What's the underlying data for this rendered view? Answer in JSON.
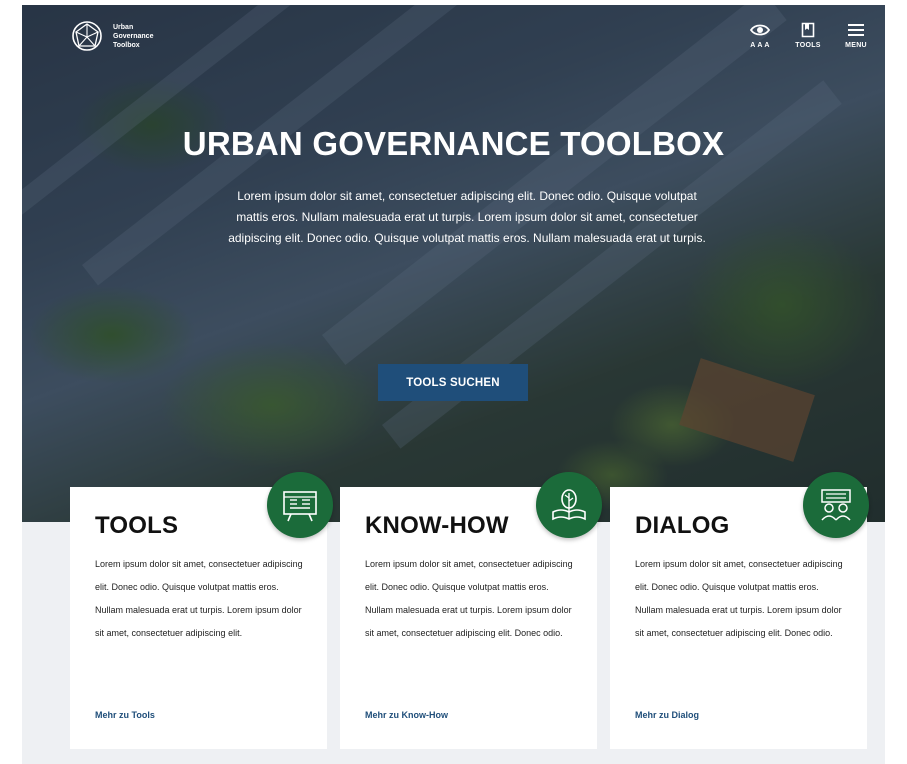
{
  "logo": {
    "line1": "Urban",
    "line2": "Governance",
    "line3": "Toolbox"
  },
  "nav": [
    {
      "label": "A A A",
      "icon": "eye-icon"
    },
    {
      "label": "TOOLS",
      "icon": "bookmark-icon"
    },
    {
      "label": "MENU",
      "icon": "menu-icon"
    }
  ],
  "hero": {
    "title": "URBAN GOVERNANCE TOOLBOX",
    "text": "Lorem ipsum dolor sit amet, consectetuer adipiscing elit. Donec odio. Quisque volutpat mattis eros. Nullam malesuada erat ut turpis. Lorem ipsum dolor sit amet, consectetuer adipiscing elit. Donec odio. Quisque volutpat mattis eros. Nullam malesuada erat ut turpis.",
    "cta": "TOOLS SUCHEN"
  },
  "cards": [
    {
      "title": "TOOLS",
      "text": "Lorem ipsum dolor sit amet, consectetuer adipiscing elit. Donec odio. Quisque volutpat mattis eros. Nullam malesuada erat ut turpis. Lorem ipsum dolor sit amet, consectetuer adipiscing elit.",
      "link": "Mehr zu Tools",
      "icon": "tools-board-icon"
    },
    {
      "title": "KNOW-HOW",
      "text": "Lorem ipsum dolor sit amet, consectetuer adipiscing elit. Donec odio. Quisque volutpat mattis eros. Nullam malesuada erat ut turpis. Lorem ipsum dolor sit amet, consectetuer adipiscing elit. Donec odio.",
      "link": "Mehr zu Know-How",
      "icon": "book-tree-icon"
    },
    {
      "title": "DIALOG",
      "text": "Lorem ipsum dolor sit amet, consectetuer adipiscing elit. Donec odio. Quisque volutpat mattis eros. Nullam malesuada erat ut turpis. Lorem ipsum dolor sit amet, consectetuer adipiscing elit. Donec odio.",
      "link": "Mehr zu Dialog",
      "icon": "people-dialog-icon"
    }
  ],
  "colors": {
    "accent": "#1f4e7a",
    "badge": "#1b6b3a",
    "background": "#eef0f3"
  }
}
